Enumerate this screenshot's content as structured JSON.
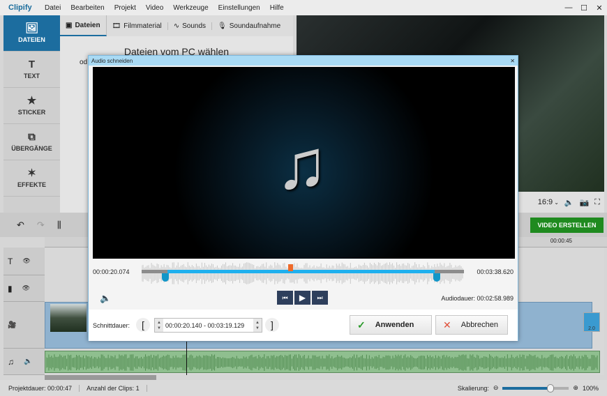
{
  "app": {
    "title": "Clipify",
    "menu": [
      "Datei",
      "Bearbeiten",
      "Projekt",
      "Video",
      "Werkzeuge",
      "Einstellungen",
      "Hilfe"
    ]
  },
  "sidebar": {
    "items": [
      {
        "label": "DATEIEN",
        "icon": "image-icon",
        "active": true
      },
      {
        "label": "TEXT",
        "icon": "text-icon"
      },
      {
        "label": "STICKER",
        "icon": "star-icon"
      },
      {
        "label": "ÜBERGÄNGE",
        "icon": "transition-icon"
      },
      {
        "label": "EFFEKTE",
        "icon": "magic-wand-icon"
      }
    ]
  },
  "content": {
    "tabs": [
      {
        "label": "Dateien",
        "icon": "image-icon",
        "active": true
      },
      {
        "label": "Filmmaterial",
        "icon": "film-icon"
      },
      {
        "label": "Sounds",
        "icon": "waveform-icon"
      },
      {
        "label": "Soundaufnahme",
        "icon": "microphone-icon"
      }
    ],
    "heading": "Dateien vom PC wählen",
    "partial": "od"
  },
  "preview": {
    "aspect": "16:9"
  },
  "toolbar": {
    "create_label": "VIDEO ERSTELLEN",
    "ruler_time": "00:00:45"
  },
  "clip": {
    "badge": "2.0"
  },
  "status": {
    "project_duration": "Projektdauer:  00:00:47",
    "clip_count": "Anzahl der Clips: 1",
    "scale_label": "Skalierung:",
    "scale_value": "100%",
    "scale_fraction": 0.72
  },
  "dialog": {
    "title": "Audio schneiden",
    "start_time": "00:00:20.074",
    "end_time": "00:03:38.620",
    "audio_duration": "Audiodauer: 00:02:58.989",
    "cut_label": "Schnittdauer:",
    "cut_value": "00:00:20.140 - 00:03:19.129",
    "apply": "Anwenden",
    "cancel": "Abbrechen",
    "selection": {
      "start_fraction": 0.08,
      "end_fraction": 0.91,
      "playhead_fraction": 0.46
    },
    "colors": {
      "selection": "#1fb0ee",
      "playhead": "#ee6a2a",
      "handle": "#1296c8"
    }
  }
}
